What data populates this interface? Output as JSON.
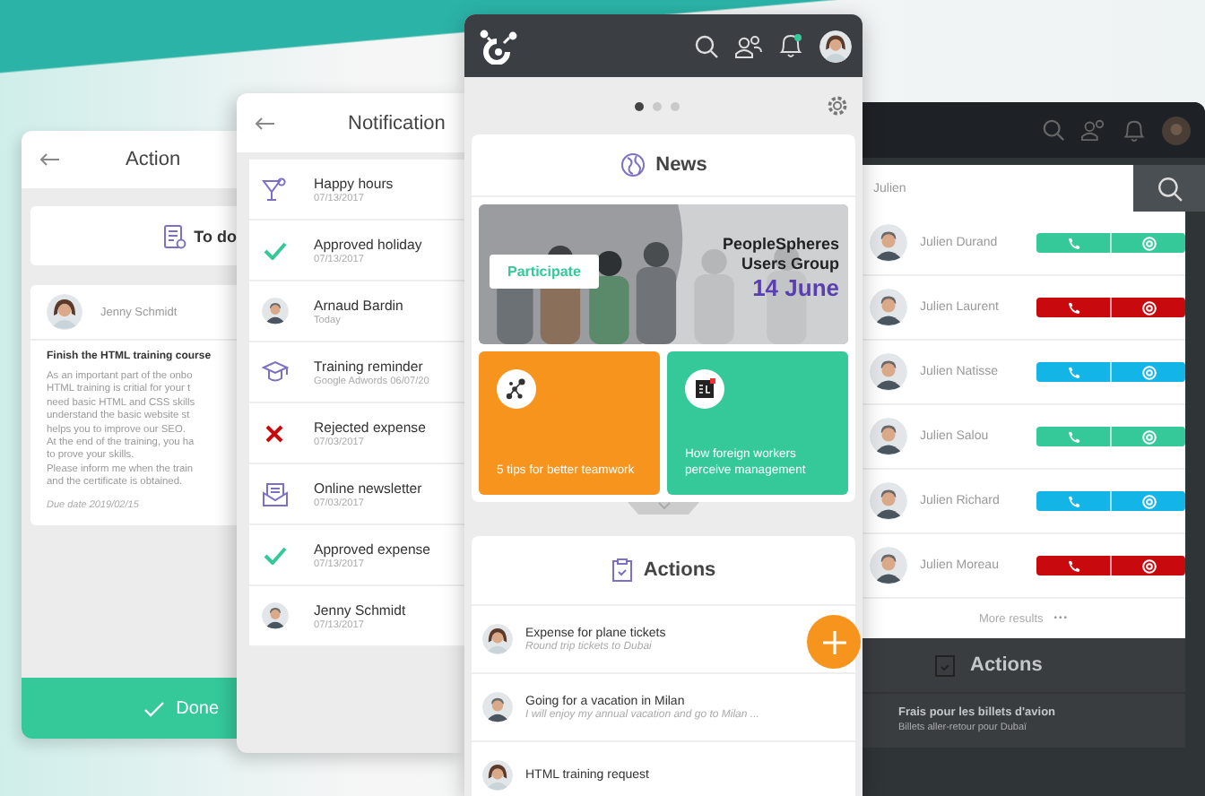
{
  "action_screen": {
    "title": "Action",
    "todo_label": "To do",
    "author": "Jenny Schmidt",
    "task_title": "Finish the HTML training course",
    "task_body": "As an important part of the onbo\nHTML training is critial for your t\nneed basic HTML and CSS skills\nunderstand the basic website st\nhelps you to improve our SEO.\nAt the end of the training, you ha\nto prove your skills.\nPlease inform me when the train\nand the certificate is obtained.",
    "due_date": "Due date 2019/02/15",
    "done_button": "Done"
  },
  "notifications_screen": {
    "title": "Notification",
    "items": [
      {
        "kind": "cocktail",
        "title": "Happy hours",
        "subtitle": "07/13/2017"
      },
      {
        "kind": "approved",
        "title": "Approved holiday",
        "subtitle": "07/13/2017"
      },
      {
        "kind": "avatar",
        "title": "Arnaud Bardin",
        "subtitle": "Today"
      },
      {
        "kind": "training",
        "title": "Training reminder",
        "subtitle": "Google Adwords 06/07/20"
      },
      {
        "kind": "rejected",
        "title": "Rejected expense",
        "subtitle": "07/03/2017"
      },
      {
        "kind": "newsletter",
        "title": "Online newsletter",
        "subtitle": "07/03/2017"
      },
      {
        "kind": "approved",
        "title": "Approved expense",
        "subtitle": "07/13/2017"
      },
      {
        "kind": "avatar",
        "title": "Jenny Schmidt",
        "subtitle": "07/13/2017"
      }
    ]
  },
  "home_screen": {
    "notification_badge": true,
    "pages": [
      {
        "selected": true
      },
      {
        "selected": false
      },
      {
        "selected": false
      }
    ],
    "news": {
      "title": "News",
      "banner": {
        "button": "Participate",
        "line_1": "PeopleSpheres",
        "line_2": "Users Group",
        "date": "14 June"
      },
      "tiles": [
        {
          "kind": "network",
          "color": "#f7941d",
          "text": "5 tips for better teamwork"
        },
        {
          "kind": "logo",
          "color": "#35c99a",
          "text": "How foreign workers perceive management"
        }
      ]
    },
    "actions": {
      "title": "Actions",
      "items": [
        {
          "title": "Expense for plane tickets",
          "subtitle": "Round trip tickets to Dubai"
        },
        {
          "title": "Going for a vacation in Milan",
          "subtitle": "I will enjoy my annual vacation and go to Milan ..."
        },
        {
          "title": "HTML training request"
        }
      ]
    }
  },
  "directory_screen": {
    "search_value": "Julien",
    "contacts": [
      {
        "name": "Julien Durand",
        "color": "#35c99a"
      },
      {
        "name": "Julien Laurent",
        "color": "#c8090e"
      },
      {
        "name": "Julien Natisse",
        "color": "#12b5e5"
      },
      {
        "name": "Julien Salou",
        "color": "#35c99a"
      },
      {
        "name": "Julien Richard",
        "color": "#12b5e5"
      },
      {
        "name": "Julien Moreau",
        "color": "#c8090e"
      }
    ],
    "more_results": "More results",
    "more_dots": "•••",
    "actions_title": "Actions",
    "action_item": {
      "title": "Frais pour les billets d'avion",
      "subtitle": "Billets aller-retour pour Dubaï"
    }
  }
}
